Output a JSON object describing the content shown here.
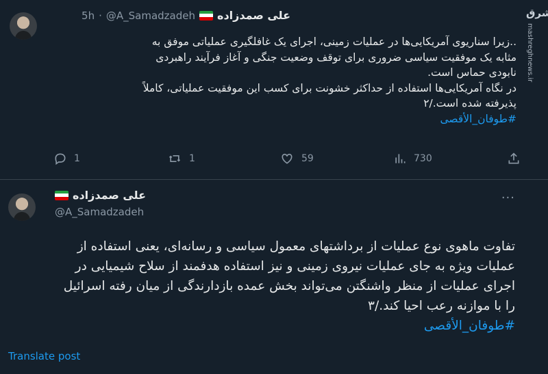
{
  "tweet1": {
    "author_name": "علی صمدزاده",
    "handle": "@A_Samadzadeh",
    "separator": "·",
    "time": "5h",
    "lines": [
      "..زیرا سناریوی آمریکایی‌ها در عملیات زمینی، اجرای یک  غافلگیری عملیاتی موفق به",
      "مثابه یک موفقیت سیاسی ضروری برای توقف وضعیت جنگی و آغاز فرآیند راهبردی",
      "نابودی حماس است.",
      "در نگاه آمریکایی‌ها استفاده از حداکثر خشونت برای کسب این موفقیت عملیاتی، کاملاً",
      "پذیرفته شده است./۲"
    ],
    "hashtag": "#طوفان_الأقصى",
    "replies": "1",
    "reposts": "1",
    "likes": "59",
    "views": "730"
  },
  "tweet2": {
    "author_name": "علی صمدزاده",
    "handle": "@A_Samadzadeh",
    "lines": [
      "تفاوت ماهوی نوع عملیات از برداشتهای معمول سیاسی و رسانه‌ای، یعنی استفاده از",
      "عملیات ویژه به جای عملیات  نیروی زمینی و نیز استفاده هدفمند از سلاح شیمیایی در",
      "اجرای عملیات از منظر واشنگتن می‌تواند بخش عمده بازدارندگی از میان رفته اسرائیل",
      "را با موازنه رعب احیا کند./۳"
    ],
    "hashtag": "#طوفان_الأقصى",
    "translate_label": "Translate post",
    "more_label": "···"
  },
  "watermark": {
    "logo": "مشرق",
    "url": "mashreghnews.ir"
  },
  "colors": {
    "background": "#15202b",
    "accent": "#1d9bf0",
    "muted": "#8b98a5",
    "text": "#e7e9ea"
  },
  "icons": [
    "reply-icon",
    "repost-icon",
    "like-icon",
    "views-icon",
    "bookmark-icon",
    "share-icon",
    "more-icon",
    "iran-flag-icon"
  ]
}
